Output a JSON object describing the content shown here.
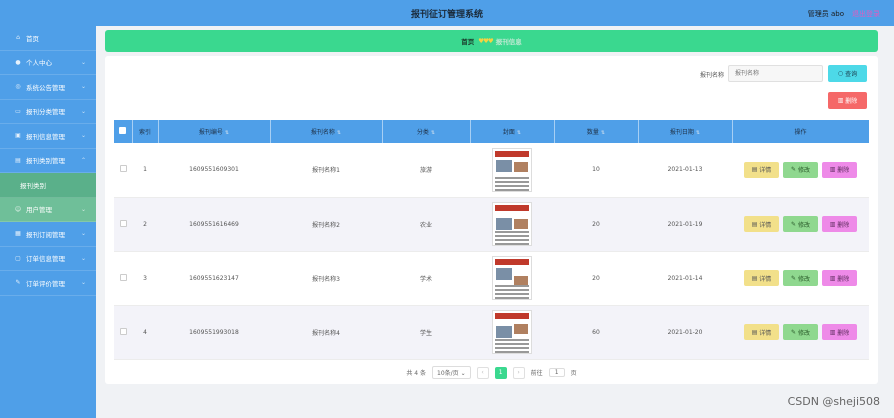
{
  "header": {
    "title": "报刊征订管理系统",
    "user": "管理员 abo",
    "logout": "退出登录"
  },
  "sidebar": {
    "items": [
      {
        "label": "首页",
        "icon": "home-icon"
      },
      {
        "label": "个人中心",
        "icon": "user-icon"
      },
      {
        "label": "系统公告管理",
        "icon": "notice-icon"
      },
      {
        "label": "报刊分类管理",
        "icon": "category-icon"
      },
      {
        "label": "报刊信息管理",
        "icon": "info-icon"
      },
      {
        "label": "报刊类别管理",
        "icon": "type-icon"
      },
      {
        "label": "报刊类别",
        "icon": "",
        "sub": true
      },
      {
        "label": "用户管理",
        "icon": "users-icon"
      },
      {
        "label": "报刊订阅管理",
        "icon": "subscribe-icon"
      },
      {
        "label": "订单信息管理",
        "icon": "order-icon"
      },
      {
        "label": "订单评价管理",
        "icon": "review-icon"
      }
    ]
  },
  "breadcrumb": {
    "home": "首页",
    "current": "报刊信息"
  },
  "search": {
    "label": "报刊名称",
    "placeholder": "报刊名称",
    "search_button": "查询",
    "delete_button": "删除"
  },
  "table": {
    "columns": [
      "索引",
      "报刊编号",
      "报刊名称",
      "分类",
      "封面",
      "数量",
      "报刊日期",
      "操作"
    ],
    "rows": [
      {
        "index": "1",
        "code": "1609551609301",
        "name": "报刊名称1",
        "category": "旅游",
        "qty": "10",
        "date": "2021-01-13"
      },
      {
        "index": "2",
        "code": "1609551616469",
        "name": "报刊名称2",
        "category": "农业",
        "qty": "20",
        "date": "2021-01-19"
      },
      {
        "index": "3",
        "code": "1609551623147",
        "name": "报刊名称3",
        "category": "学术",
        "qty": "20",
        "date": "2021-01-14"
      },
      {
        "index": "4",
        "code": "1609551993018",
        "name": "报刊名称4",
        "category": "学生",
        "qty": "60",
        "date": "2021-01-20"
      }
    ],
    "op_detail": "详情",
    "op_edit": "修改",
    "op_delete": "删除"
  },
  "pagination": {
    "total": "共 4 条",
    "page_size": "10条/页",
    "current": "1",
    "goto_label": "前往",
    "goto_value": "1",
    "goto_suffix": "页"
  },
  "watermark": "CSDN @sheji508",
  "colors": {
    "primary": "#4f9fe8",
    "accent": "#3ad88f",
    "danger": "#f56868"
  }
}
